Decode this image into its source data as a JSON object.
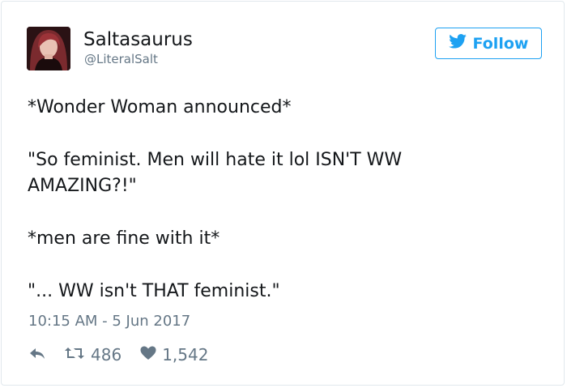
{
  "user": {
    "name": "Saltasaurus",
    "handle": "@LiteralSalt",
    "follow_label": "Follow"
  },
  "tweet": {
    "line1": "*Wonder Woman announced*",
    "line2": "\"So feminist. Men will hate it lol ISN'T WW",
    "line3": "AMAZING?!\"",
    "line4": "*men are fine with it*",
    "line5": "\"... WW isn't THAT feminist.\""
  },
  "timestamp": "10:15 AM - 5 Jun 2017",
  "stats": {
    "retweets": "486",
    "likes": "1,542"
  },
  "colors": {
    "accent": "#1da1f2",
    "secondary_text": "#657786",
    "primary_text": "#14171a",
    "border": "#e1e8ed"
  },
  "icons": [
    "twitter-bird-icon",
    "reply-icon",
    "retweet-icon",
    "heart-icon"
  ]
}
